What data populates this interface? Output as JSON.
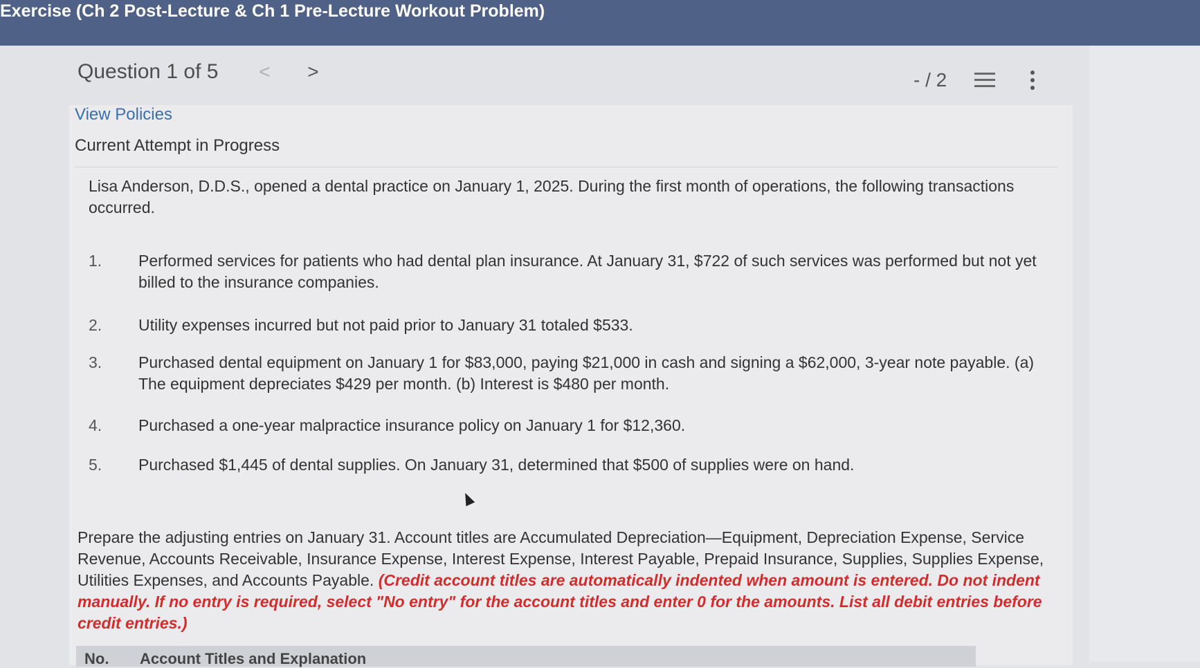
{
  "header": {
    "title": "Exercise (Ch 2 Post-Lecture & Ch 1 Pre-Lecture Workout Problem)"
  },
  "question_nav": {
    "label": "Question 1 of 5",
    "prev": "<",
    "next": ">",
    "score": "- / 2"
  },
  "view_policies": "View Policies",
  "attempt_status": "Current Attempt in Progress",
  "problem": {
    "intro": "Lisa Anderson, D.D.S., opened a dental practice on January 1, 2025. During the first month of operations, the following transactions occurred.",
    "transactions": [
      {
        "num": "1.",
        "text": "Performed services for patients who had dental plan insurance. At January 31, $722 of such services was performed but not yet billed to the insurance companies."
      },
      {
        "num": "2.",
        "text": "Utility expenses incurred but not paid prior to January 31 totaled $533."
      },
      {
        "num": "3.",
        "text": "Purchased dental equipment on January 1 for $83,000, paying $21,000 in cash and signing a $62,000, 3-year note payable. (a) The equipment depreciates $429 per month. (b) Interest is $480 per month."
      },
      {
        "num": "4.",
        "text": "Purchased a one-year malpractice insurance policy on January 1 for $12,360."
      },
      {
        "num": "5.",
        "text": "Purchased $1,445 of dental supplies. On January 31, determined that $500 of supplies were on hand."
      }
    ],
    "instructions": "Prepare the adjusting entries on January 31. Account titles are Accumulated Depreciation—Equipment, Depreciation Expense, Service Revenue, Accounts Receivable, Insurance Expense, Interest Expense, Interest Payable, Prepaid Insurance, Supplies, Supplies Expense, Utilities Expenses, and Accounts Payable.",
    "instructions_note": "(Credit account titles are automatically indented when amount is entered. Do not indent manually. If no entry is required, select \"No entry\" for the account titles and enter 0 for the amounts. List all debit entries before credit entries.)"
  },
  "table": {
    "col_no": "No.",
    "col_account": "Account Titles and Explanation"
  }
}
